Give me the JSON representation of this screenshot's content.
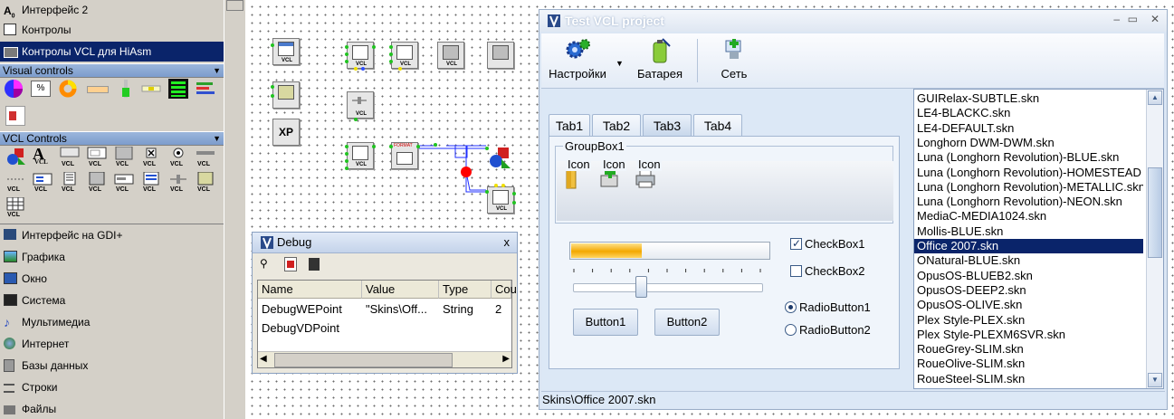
{
  "palette": {
    "top_items": [
      {
        "label": "Интерфейс 2",
        "icon": "text-a0-icon"
      },
      {
        "label": "Контролы",
        "icon": "window-icon"
      },
      {
        "label": "Контролы VCL для HiAsm",
        "icon": "vcl-controls-icon"
      }
    ],
    "visual_controls_header": "Visual controls",
    "vcl_controls_header": "VCL Controls",
    "bottom_items": [
      {
        "label": "Интерфейс на GDI+",
        "icon": "gdi-icon"
      },
      {
        "label": "Графика",
        "icon": "graphics-icon"
      },
      {
        "label": "Окно",
        "icon": "window-icon"
      },
      {
        "label": "Система",
        "icon": "system-icon"
      },
      {
        "label": "Мультимедиа",
        "icon": "music-note-icon"
      },
      {
        "label": "Интернет",
        "icon": "globe-icon"
      },
      {
        "label": "Базы данных",
        "icon": "database-icon"
      },
      {
        "label": "Строки",
        "icon": "strings-icon"
      },
      {
        "label": "Файлы",
        "icon": "folder-icon"
      }
    ],
    "vcl_badge": "VCL",
    "percent_glyph": "%",
    "xp_label": "XP"
  },
  "canvas": {
    "format_label": "FORMAT"
  },
  "debug": {
    "title": "Debug",
    "close": "x",
    "columns": [
      "Name",
      "Value",
      "Type",
      "Cou"
    ],
    "rows": [
      {
        "name": "DebugWEPoint",
        "value": "\"Skins\\Off...",
        "type": "String",
        "count": "2"
      },
      {
        "name": "DebugVDPoint",
        "value": "",
        "type": "",
        "count": ""
      }
    ]
  },
  "vcl": {
    "title": "Test VCL project",
    "toolbar": [
      {
        "label": "Настройки",
        "icon": "gears-icon"
      },
      {
        "label": "Батарея",
        "icon": "battery-icon"
      },
      {
        "label": "Сеть",
        "icon": "network-icon"
      }
    ],
    "tabs": [
      "Tab1",
      "Tab2",
      "Tab3",
      "Tab4"
    ],
    "selected_tab": "Tab3",
    "groupbox_label": "GroupBox1",
    "group_icons": [
      {
        "label": "Icon",
        "icon": "folder-icon"
      },
      {
        "label": "Icon",
        "icon": "add-icon"
      },
      {
        "label": "Icon",
        "icon": "printer-icon"
      }
    ],
    "progress_fraction": 0.36,
    "slider_fraction": 0.35,
    "checkbox1": {
      "label": "CheckBox1",
      "checked": true
    },
    "checkbox2": {
      "label": "CheckBox2",
      "checked": false
    },
    "radio1": {
      "label": "RadioButton1",
      "checked": true
    },
    "radio2": {
      "label": "RadioButton2",
      "checked": false
    },
    "button1": "Button1",
    "button2": "Button2",
    "skins": [
      "GUIRelax-SUBTLE.skn",
      "LE4-BLACKC.skn",
      "LE4-DEFAULT.skn",
      "Longhorn DWM-DWM.skn",
      "Luna (Longhorn Revolution)-BLUE.skn",
      "Luna (Longhorn Revolution)-HOMESTEAD",
      "Luna (Longhorn Revolution)-METALLIC.skn",
      "Luna (Longhorn Revolution)-NEON.skn",
      "MediaC-MEDIA1024.skn",
      "Mollis-BLUE.skn",
      "Office 2007.skn",
      "ONatural-BLUE.skn",
      "OpusOS-BLUEB2.skn",
      "OpusOS-DEEP2.skn",
      "OpusOS-OLIVE.skn",
      "Plex Style-PLEX.skn",
      "Plex Style-PLEXM6SVR.skn",
      "RoueGrey-SLIM.skn",
      "RoueOlive-SLIM.skn",
      "RoueSteel-SLIM.skn"
    ],
    "selected_skin": "Office 2007.skn",
    "status": "Skins\\Office 2007.skn"
  },
  "colors": {
    "selection": "#0a246a",
    "progress": "#f3a800",
    "pin_green": "#21c321",
    "link_red": "#ff0000"
  }
}
